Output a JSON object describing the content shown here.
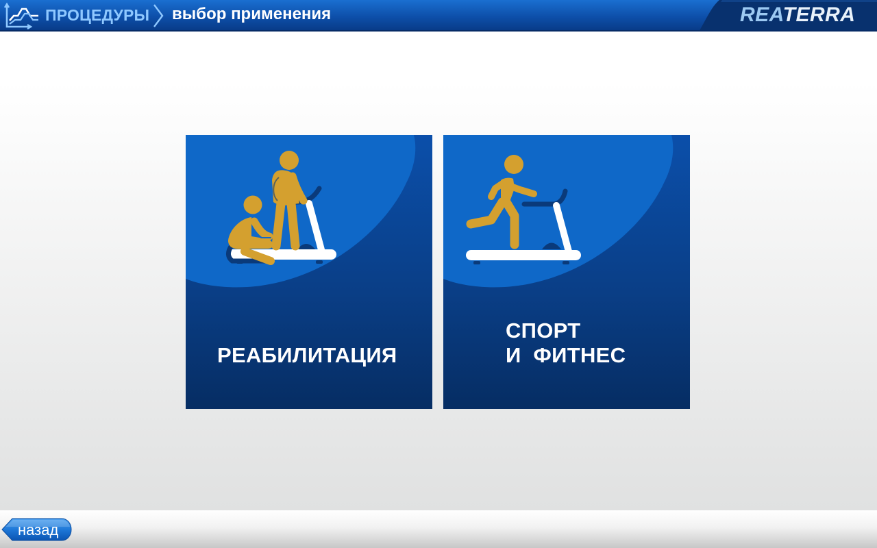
{
  "header": {
    "breadcrumb_root": "ПРОЦЕДУРЫ",
    "current_page": "выбор применения",
    "brand_part1": "REA",
    "brand_part2": "TERRA",
    "home_icon": "procedures-chart-icon",
    "separator_icon": "chevron-right-icon"
  },
  "tiles": [
    {
      "id": "rehab",
      "label": "РЕАБИЛИТАЦИЯ",
      "icon": "rehabilitation-treadmill-icon"
    },
    {
      "id": "sport",
      "label": "СПОРТ\nИ  ФИТНЕС",
      "icon": "running-treadmill-icon"
    }
  ],
  "footer": {
    "back_label": "назад"
  },
  "colors": {
    "header_blue": "#0d4ea8",
    "tile_blue": "#0b4faa",
    "tile_light_blue": "#0f68c8",
    "figure_gold": "#d4a02f",
    "treadmill_white": "#ffffff",
    "treadmill_dark": "#0a3a7a"
  }
}
